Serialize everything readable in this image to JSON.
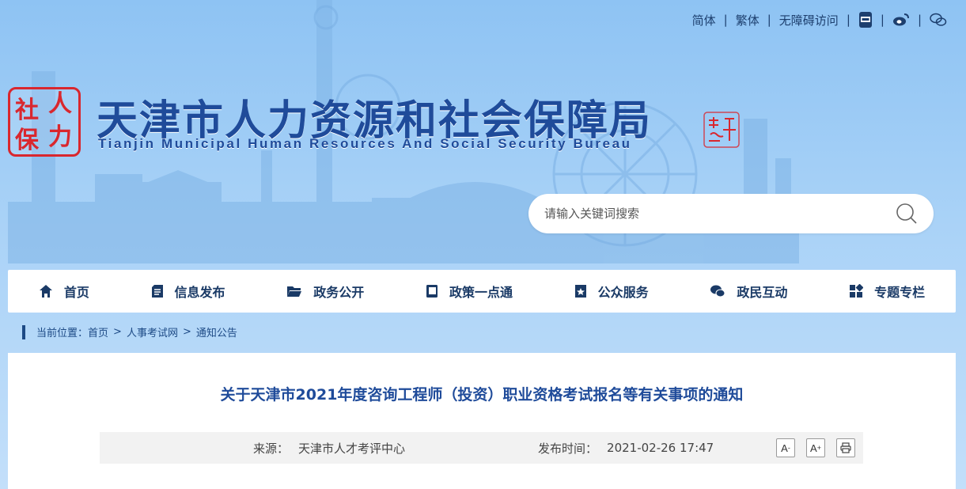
{
  "top_links": {
    "simplified": "简体",
    "traditional": "繁体",
    "accessible": "无障碍访问",
    "separator": "|"
  },
  "header": {
    "seal_chars": [
      "人",
      "社",
      "力",
      "保"
    ],
    "title_cn": "天津市人力资源和社会保障局",
    "title_en": "Tianjin Municipal Human Resources And Social Security Bureau"
  },
  "search": {
    "placeholder": "请输入关键词搜索"
  },
  "nav": {
    "items": [
      {
        "label": "首页",
        "icon": "home-icon"
      },
      {
        "label": "信息发布",
        "icon": "document-icon"
      },
      {
        "label": "政务公开",
        "icon": "folder-icon"
      },
      {
        "label": "政策一点通",
        "icon": "book-icon"
      },
      {
        "label": "公众服务",
        "icon": "bookmark-star-icon"
      },
      {
        "label": "政民互动",
        "icon": "chat-icon"
      },
      {
        "label": "专题专栏",
        "icon": "grid-icon"
      }
    ]
  },
  "breadcrumb": {
    "prefix": "当前位置：",
    "items": [
      "首页",
      "人事考试网",
      "通知公告"
    ],
    "separator": ">"
  },
  "article": {
    "title": "关于天津市2021年度咨询工程师（投资）职业资格考试报名等有关事项的通知",
    "source_label": "来源：",
    "source_value": "天津市人才考评中心",
    "time_label": "发布时间：",
    "time_value": "2021-02-26 17:47",
    "font_decrease": "A",
    "font_decrease_sign": "-",
    "font_increase": "A",
    "font_increase_sign": "+"
  },
  "colors": {
    "brand_blue": "#1f4b9a",
    "seal_red": "#d9272e",
    "nav_text": "#1a3a66"
  }
}
